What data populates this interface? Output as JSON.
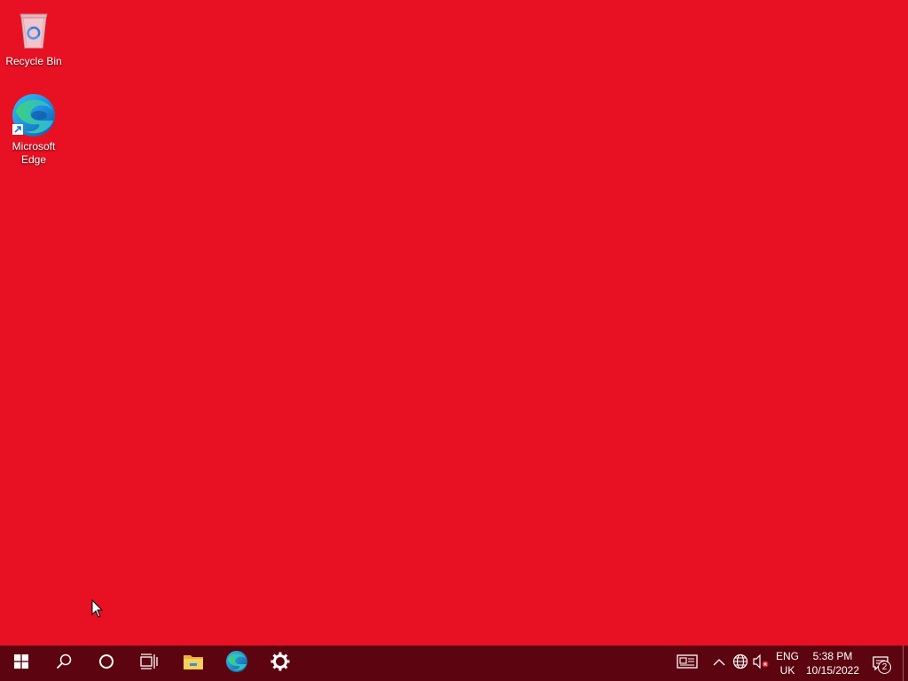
{
  "desktop": {
    "background_color": "#e81123",
    "icons": [
      {
        "label": "Recycle Bin",
        "icon": "recycle-bin-icon"
      },
      {
        "label": "Microsoft Edge",
        "icon": "edge-icon"
      }
    ]
  },
  "taskbar": {
    "background_color": "#5c0510",
    "buttons": [
      {
        "icon": "windows-start-icon"
      },
      {
        "icon": "search-icon"
      },
      {
        "icon": "cortana-icon"
      },
      {
        "icon": "task-view-icon"
      },
      {
        "icon": "file-explorer-icon"
      },
      {
        "icon": "edge-icon"
      },
      {
        "icon": "settings-gear-icon"
      }
    ],
    "tray": {
      "icons": [
        "news-and-interests-icon",
        "chevron-up-icon",
        "network-globe-icon",
        "volume-muted-icon"
      ],
      "language_line1": "ENG",
      "language_line2": "UK",
      "time": "5:38 PM",
      "date": "10/15/2022",
      "notifications_icon": "action-center-icon",
      "notifications_count": "2"
    }
  }
}
